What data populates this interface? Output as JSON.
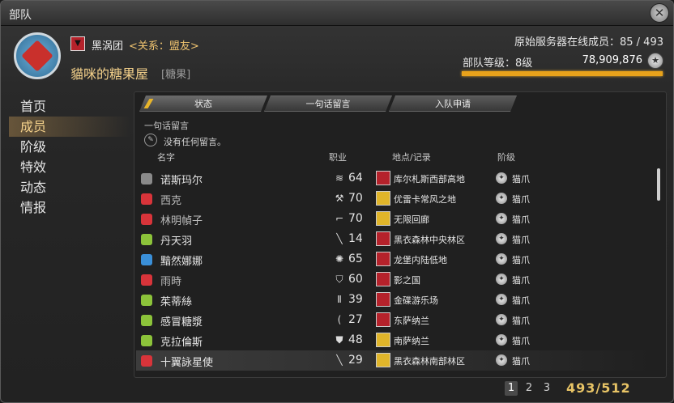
{
  "window": {
    "title": "部队"
  },
  "header": {
    "grand_company": "黑涡团",
    "relation": "<关系：盟友>",
    "fc_name": "貓咪的糖果屋",
    "fc_tag": "[糖果]",
    "online_members": "原始服务器在线成员：85 / 493",
    "rank": "部队等级：8级",
    "credits": "78,909,876",
    "rank_progress_fraction": 1.0
  },
  "sidebar": {
    "items": [
      {
        "label": "首页"
      },
      {
        "label": "成员"
      },
      {
        "label": "阶级"
      },
      {
        "label": "特效"
      },
      {
        "label": "动态"
      },
      {
        "label": "情报"
      }
    ],
    "active_index": 1
  },
  "tabs": [
    {
      "label": "状态"
    },
    {
      "label": "一句话留言"
    },
    {
      "label": "入队申请"
    }
  ],
  "note": {
    "label": "一句话留言",
    "text": "没有任何留言。"
  },
  "columns": {
    "name": "名字",
    "job": "职业",
    "location": "地点/记录",
    "rank": "阶级"
  },
  "members": [
    {
      "name": "诺斯玛尔",
      "job_icon": "bard-icon",
      "level": "64",
      "loc_color": "#b5222b",
      "location": "库尔札斯西部高地",
      "rank": "猫爪",
      "icon_color": "#8a8a8a",
      "dim": false
    },
    {
      "name": "西克",
      "job_icon": "warrior-icon",
      "level": "70",
      "loc_color": "#e0b52a",
      "location": "优雷卡常风之地",
      "rank": "猫爪",
      "icon_color": "#d8343a",
      "dim": true
    },
    {
      "name": "林明幀子",
      "job_icon": "machinist-icon",
      "level": "70",
      "loc_color": "#e0b52a",
      "location": "无限回廊",
      "rank": "猫爪",
      "icon_color": "#d8343a",
      "dim": true
    },
    {
      "name": "丹天羽",
      "job_icon": "dragoon-icon",
      "level": "14",
      "loc_color": "#b5222b",
      "location": "黑衣森林中央林区",
      "rank": "猫爪",
      "icon_color": "#8cc33a",
      "dim": false
    },
    {
      "name": "黯然娜娜",
      "job_icon": "astrologian-icon",
      "level": "65",
      "loc_color": "#b5222b",
      "location": "龙堡内陆低地",
      "rank": "猫爪",
      "icon_color": "#3a8fd8",
      "dim": false
    },
    {
      "name": "雨時",
      "job_icon": "paladin-icon",
      "level": "60",
      "loc_color": "#b5222b",
      "location": "影之国",
      "rank": "猫爪",
      "icon_color": "#d8343a",
      "dim": true
    },
    {
      "name": "茱蒂絲",
      "job_icon": "monk-icon",
      "level": "39",
      "loc_color": "#b5222b",
      "location": "金碟游乐场",
      "rank": "猫爪",
      "icon_color": "#8cc33a",
      "dim": false
    },
    {
      "name": "感冒糖漿",
      "job_icon": "bard-bow-icon",
      "level": "27",
      "loc_color": "#b5222b",
      "location": "东萨纳兰",
      "rank": "猫爪",
      "icon_color": "#8cc33a",
      "dim": false
    },
    {
      "name": "克拉倫斯",
      "job_icon": "knight-icon",
      "level": "48",
      "loc_color": "#e0b52a",
      "location": "南萨纳兰",
      "rank": "猫爪",
      "icon_color": "#8cc33a",
      "dim": false
    },
    {
      "name": "十翼詠星使",
      "job_icon": "lancer-icon",
      "level": "29",
      "loc_color": "#e0b52a",
      "location": "黑衣森林南部林区",
      "rank": "猫爪",
      "icon_color": "#d8343a",
      "dim": false
    }
  ],
  "selected_row": 9,
  "pager": {
    "pages": [
      "1",
      "2",
      "3"
    ],
    "active": "1",
    "count": "493/512"
  }
}
